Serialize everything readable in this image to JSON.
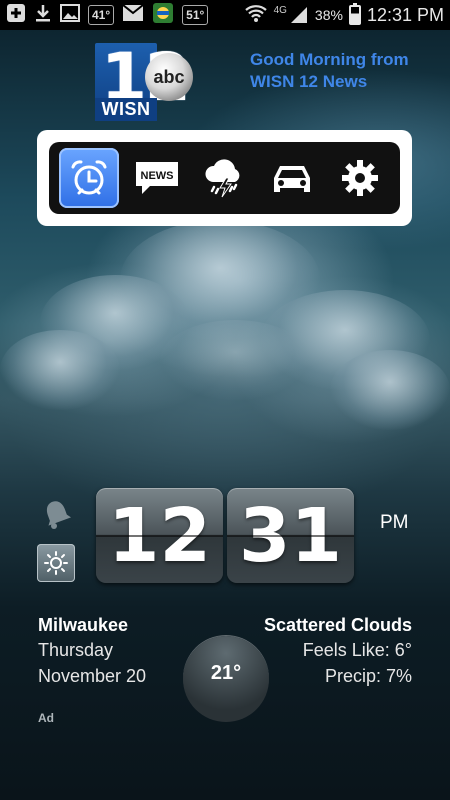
{
  "status_bar": {
    "icons": [
      "plus-icon",
      "download-icon",
      "image-icon",
      "weather-badge-icon",
      "gmail-icon",
      "app-badge-icon",
      "temperature-badge-icon",
      "wifi-icon",
      "lte-signal-icon",
      "battery-icon"
    ],
    "badge_temp_1": "41°",
    "badge_temp_2": "51°",
    "network": "4G",
    "battery": "38%",
    "time": "12:31 PM"
  },
  "header": {
    "logo_number": "12",
    "logo_network": "abc",
    "logo_callsign": "WISN",
    "greeting": "Good Morning from WISN 12 News",
    "greeting_color": "#3f86e8"
  },
  "toolbar": {
    "items": [
      {
        "icon": "alarm-clock-icon",
        "active": true
      },
      {
        "icon": "news-icon",
        "label": "NEWS"
      },
      {
        "icon": "storm-icon"
      },
      {
        "icon": "car-icon"
      },
      {
        "icon": "gear-icon"
      }
    ],
    "active_color": "#2f6fe6"
  },
  "clock": {
    "hour": "12",
    "minute": "31",
    "ampm": "PM"
  },
  "weather": {
    "city": "Milwaukee",
    "day": "Thursday",
    "date": "November 20",
    "condition": "Scattered Clouds",
    "feels_like": "Feels Like: 6°",
    "precip": "Precip: 7%",
    "temperature": "21°"
  },
  "ad_label": "Ad"
}
